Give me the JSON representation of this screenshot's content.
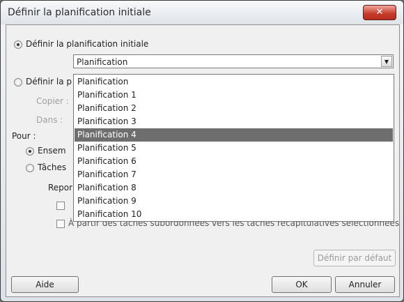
{
  "dialog": {
    "title": "Définir la planification initiale",
    "close_glyph": "✕"
  },
  "options": {
    "set_baseline_label": "Définir la planification initiale",
    "set_interim_label": "Définir la p",
    "copy_label": "Copier :",
    "into_label": "Dans :",
    "for_label": "Pour :",
    "entire_label": "Ensem",
    "selected_tasks_label": "Tâches",
    "rollup_label": "Repor",
    "rollup_opt1": "",
    "rollup_opt2": "À partir des tâches subordonnées vers les tâches récapitulatives sélectionnées"
  },
  "combo": {
    "value": "Planification",
    "arrow_glyph": "▼"
  },
  "dropdown": {
    "items": [
      "Planification",
      "Planification 1",
      "Planification 2",
      "Planification 3",
      "Planification 4",
      "Planification 5",
      "Planification 6",
      "Planification 7",
      "Planification 8",
      "Planification 9",
      "Planification 10"
    ],
    "selected_index": 4
  },
  "buttons": {
    "set_default": "Définir par défaut",
    "help": "Aide",
    "ok": "OK",
    "cancel": "Annuler"
  }
}
